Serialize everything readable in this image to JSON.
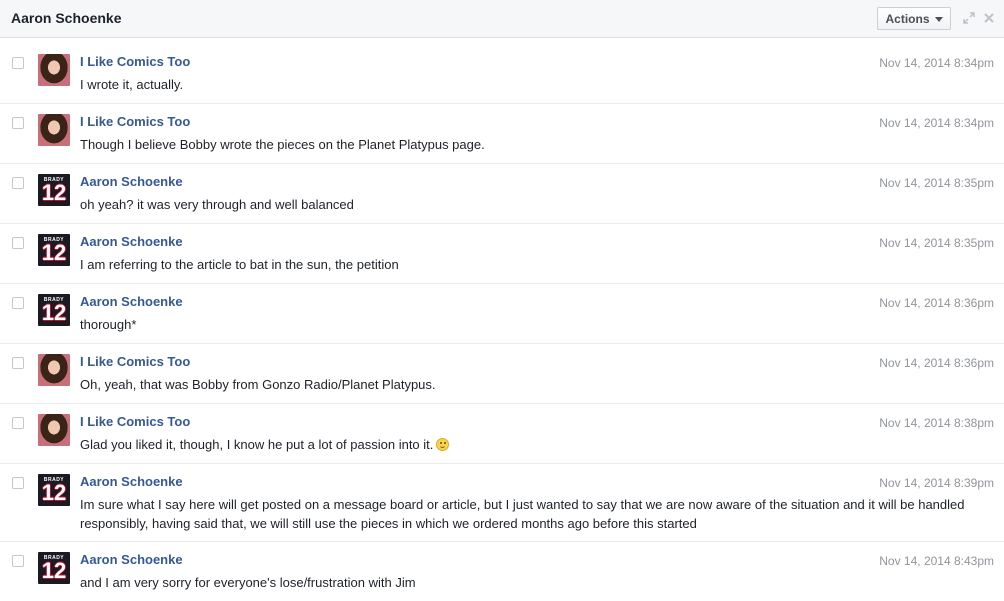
{
  "header": {
    "title": "Aaron Schoenke",
    "actions_label": "Actions"
  },
  "avatars": {
    "comics": "woman-portrait",
    "aaron": "brady-12-jersey",
    "brady_name": "BRADY",
    "brady_number": "12"
  },
  "messages": [
    {
      "sender": "I Like Comics Too",
      "avatar": "comics",
      "time": "Nov 14, 2014 8:34pm",
      "text": "I wrote it, actually."
    },
    {
      "sender": "I Like Comics Too",
      "avatar": "comics",
      "time": "Nov 14, 2014 8:34pm",
      "text": "Though I believe Bobby wrote the pieces on the Planet Platypus page."
    },
    {
      "sender": "Aaron Schoenke",
      "avatar": "aaron",
      "time": "Nov 14, 2014 8:35pm",
      "text": "oh yeah? it was very through and well balanced"
    },
    {
      "sender": "Aaron Schoenke",
      "avatar": "aaron",
      "time": "Nov 14, 2014 8:35pm",
      "text": "I am referring to the article to bat in the sun, the petition"
    },
    {
      "sender": "Aaron Schoenke",
      "avatar": "aaron",
      "time": "Nov 14, 2014 8:36pm",
      "text": "thorough*"
    },
    {
      "sender": "I Like Comics Too",
      "avatar": "comics",
      "time": "Nov 14, 2014 8:36pm",
      "text": "Oh, yeah, that was Bobby from Gonzo Radio/Planet Platypus."
    },
    {
      "sender": "I Like Comics Too",
      "avatar": "comics",
      "time": "Nov 14, 2014 8:38pm",
      "text": "Glad you liked it, though, I know he put a lot of passion into it.",
      "emoji": "smiley-icon"
    },
    {
      "sender": "Aaron Schoenke",
      "avatar": "aaron",
      "time": "Nov 14, 2014 8:39pm",
      "text": "Im sure what I say here will get posted on a message board or article, but I just wanted to say that we are now aware of the situation and it will be handled responsibly, having said that, we will still use the pieces in which we ordered months ago before this started"
    },
    {
      "sender": "Aaron Schoenke",
      "avatar": "aaron",
      "time": "Nov 14, 2014 8:43pm",
      "text": "and I am very sorry for everyone's lose/frustration with Jim"
    }
  ],
  "colors": {
    "link": "#365899",
    "timestamp": "#90949c",
    "header_bg": "#f6f7f9"
  }
}
